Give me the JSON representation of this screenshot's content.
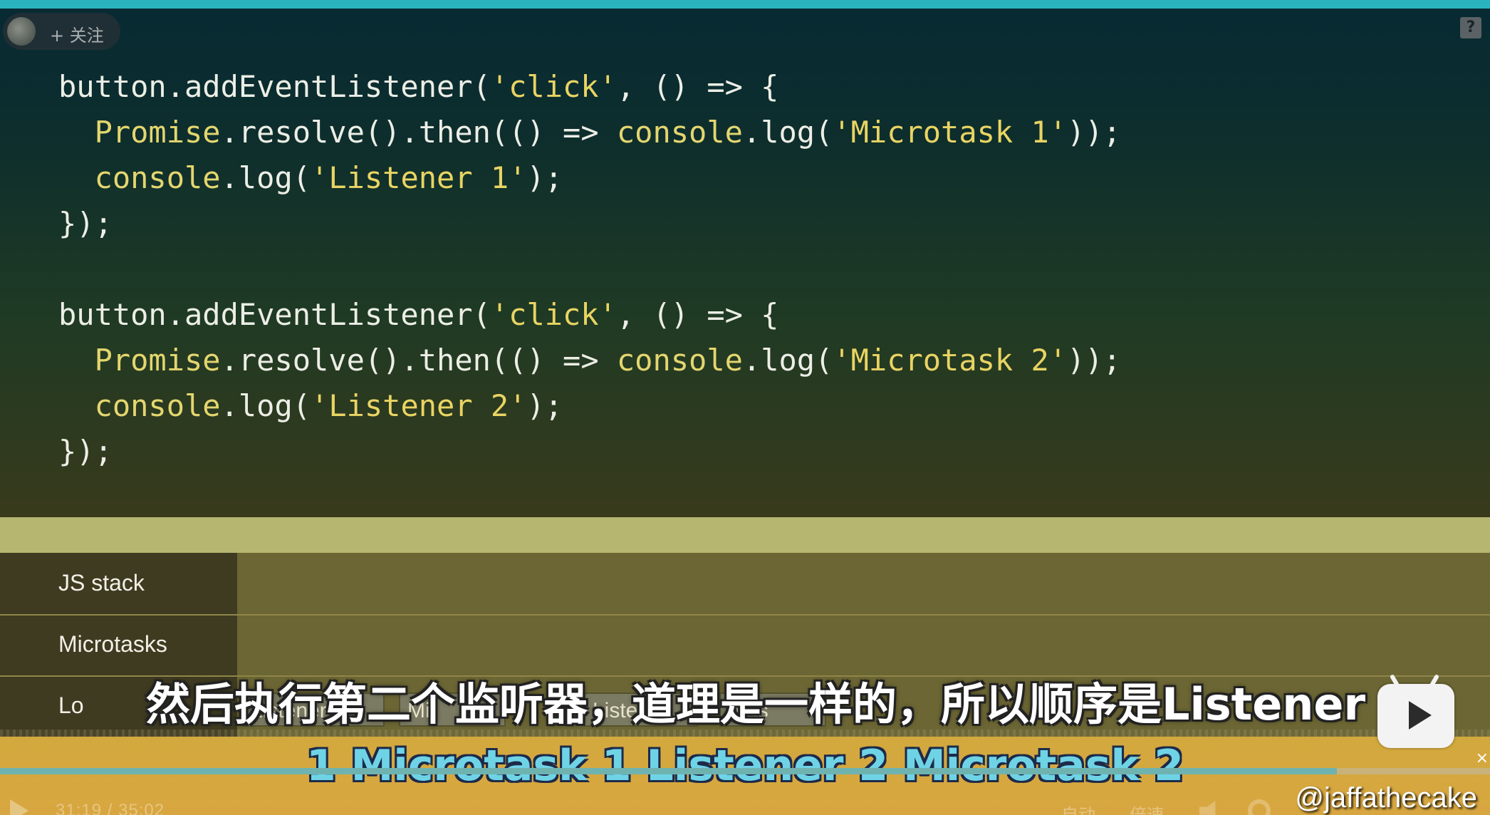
{
  "top_overlay": {
    "follow_label": "+ 关注"
  },
  "code": {
    "lines": [
      [
        {
          "t": "button.addEventListener(",
          "c": "id"
        },
        {
          "t": "'click'",
          "c": "str"
        },
        {
          "t": ", () => {",
          "c": "id"
        }
      ],
      [
        {
          "t": "  ",
          "c": "id"
        },
        {
          "t": "Promise",
          "c": "ylw"
        },
        {
          "t": ".resolve().then(() => ",
          "c": "id"
        },
        {
          "t": "console",
          "c": "ylw"
        },
        {
          "t": ".log(",
          "c": "id"
        },
        {
          "t": "'Microtask 1'",
          "c": "str"
        },
        {
          "t": "));",
          "c": "id"
        }
      ],
      [
        {
          "t": "  ",
          "c": "id"
        },
        {
          "t": "console",
          "c": "ylw"
        },
        {
          "t": ".log(",
          "c": "id"
        },
        {
          "t": "'Listener 1'",
          "c": "str"
        },
        {
          "t": ");",
          "c": "id"
        }
      ],
      [
        {
          "t": "});",
          "c": "id"
        }
      ],
      [
        {
          "t": "",
          "c": "id"
        }
      ],
      [
        {
          "t": "button.addEventListener(",
          "c": "id"
        },
        {
          "t": "'click'",
          "c": "str"
        },
        {
          "t": ", () => {",
          "c": "id"
        }
      ],
      [
        {
          "t": "  ",
          "c": "id"
        },
        {
          "t": "Promise",
          "c": "ylw"
        },
        {
          "t": ".resolve().then(() => ",
          "c": "id"
        },
        {
          "t": "console",
          "c": "ylw"
        },
        {
          "t": ".log(",
          "c": "id"
        },
        {
          "t": "'Microtask 2'",
          "c": "str"
        },
        {
          "t": "));",
          "c": "id"
        }
      ],
      [
        {
          "t": "  ",
          "c": "id"
        },
        {
          "t": "console",
          "c": "ylw"
        },
        {
          "t": ".log(",
          "c": "id"
        },
        {
          "t": "'Listener 2'",
          "c": "str"
        },
        {
          "t": ");",
          "c": "id"
        }
      ],
      [
        {
          "t": "});",
          "c": "id"
        }
      ]
    ]
  },
  "panel": {
    "rows": [
      "JS stack",
      "Microtasks",
      "Lo"
    ],
    "log_items": [
      "Listener 1",
      "Mi",
      "Liste",
      "otas"
    ]
  },
  "subtitle": {
    "line1": "然后执行第二个监听器，道理是一样的，所以顺序是Listener",
    "line2": "1 Microtask 1 Listener 2 Microtask 2"
  },
  "player": {
    "time": "31:19 / 35:02",
    "auto_label": "自动",
    "speed_label": "倍速",
    "progress": 0.897,
    "watermark": "@jaffathecake"
  },
  "colors": {
    "code_text": "#eceee6",
    "code_keyword": "#e4d66f",
    "code_string": "#e9d463",
    "subtitle_en": "#6fd3e6",
    "band": "#b7b670"
  }
}
